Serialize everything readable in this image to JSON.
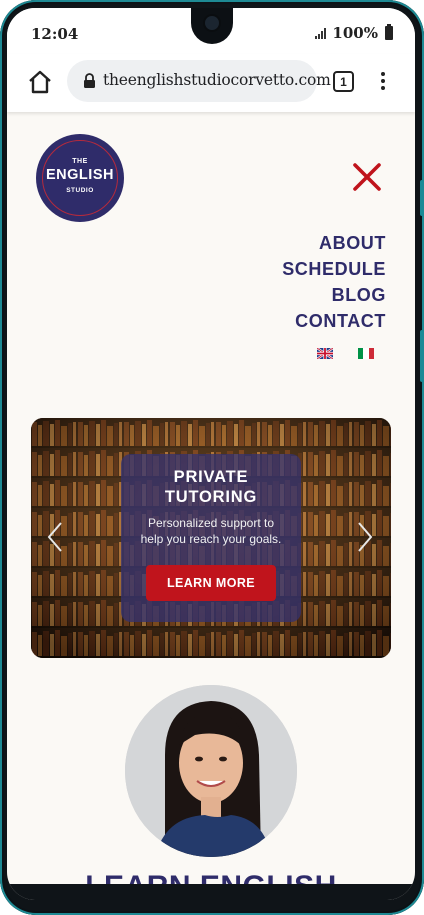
{
  "status_bar": {
    "time": "12:04",
    "battery_percent": "100%",
    "signal_icon": "signal-bars-icon",
    "battery_icon": "battery-icon"
  },
  "browser": {
    "url": "theenglishstudiocorvetto.com",
    "tab_count": "1",
    "home_icon": "home-icon",
    "lock_icon": "lock-icon",
    "menu_icon": "more-vertical-icon"
  },
  "site": {
    "logo": {
      "line1": "THE",
      "line2": "ENGLISH",
      "line3": "STUDIO"
    },
    "close_icon": "close-x-icon",
    "nav": [
      {
        "label": "ABOUT"
      },
      {
        "label": "SCHEDULE"
      },
      {
        "label": "BLOG"
      },
      {
        "label": "CONTACT"
      }
    ],
    "languages": [
      {
        "icon": "uk-flag-icon"
      },
      {
        "icon": "italy-flag-icon"
      }
    ],
    "carousel": {
      "slide_title_line1": "PRIVATE",
      "slide_title_line2": "TUTORING",
      "slide_sub_line1": "Personalized support to",
      "slide_sub_line2": "help you reach your goals.",
      "button_label": "LEARN MORE",
      "prev_icon": "chevron-left-icon",
      "next_icon": "chevron-right-icon"
    },
    "section_heading": "LEARN ENGLISH"
  },
  "colors": {
    "brand_navy": "#2f2c6a",
    "brand_red": "#c0141c",
    "page_bg": "#fbf9f5"
  }
}
